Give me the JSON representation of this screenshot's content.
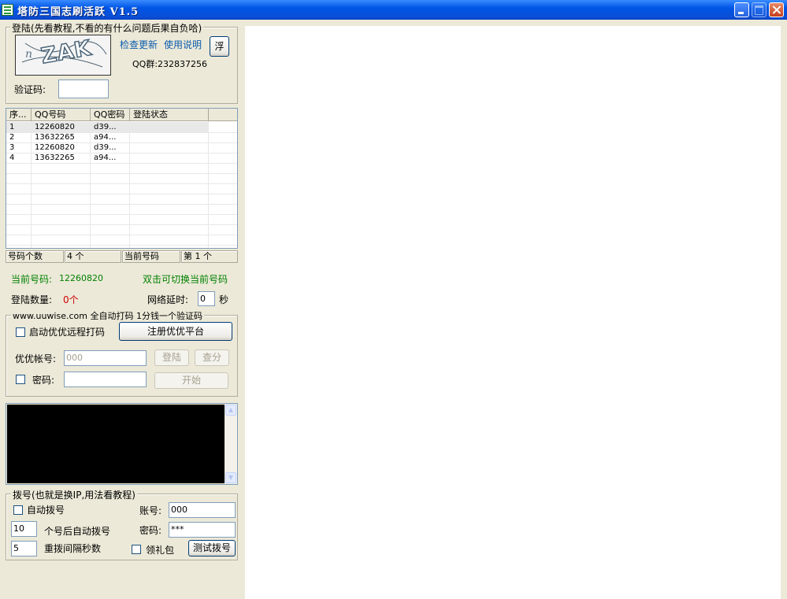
{
  "window": {
    "title": "塔防三国志刷活跃 V1.5"
  },
  "login": {
    "group_title": "登陆(先看教程,不看的有什么问题后果自负哈)",
    "captcha_text": "ZAK",
    "check_update": "检查更新",
    "instructions": "使用说明",
    "float_button": "浮",
    "qq_group": "QQ群:232837256",
    "captcha_label": "验证码:",
    "captcha_value": ""
  },
  "accounts": {
    "columns": [
      "序...",
      "QQ号码",
      "QQ密码",
      "登陆状态"
    ],
    "rows": [
      {
        "no": "1",
        "qq": "12260820",
        "pwd": "d39...",
        "status": ""
      },
      {
        "no": "2",
        "qq": "13632265",
        "pwd": "a94...",
        "status": ""
      },
      {
        "no": "3",
        "qq": "12260820",
        "pwd": "d39...",
        "status": ""
      },
      {
        "no": "4",
        "qq": "13632265",
        "pwd": "a94...",
        "status": ""
      }
    ],
    "status_bar": [
      "号码个数",
      "4 个",
      "当前号码",
      "第 1 个"
    ]
  },
  "current": {
    "label": "当前号码:",
    "value": "12260820",
    "hint": "双击可切换当前号码",
    "login_count_label": "登陆数量:",
    "login_count_value": "0个",
    "delay_label": "网络延时:",
    "delay_value": "0",
    "delay_unit": "秒"
  },
  "uuwise": {
    "group_title": "www.uuwise.com 全自动打码 1分钱一个验证码",
    "enable_label": "启动优优远程打码",
    "register_button": "注册优优平台",
    "account_label": "优优帐号:",
    "account_value": "000",
    "login_button": "登陆",
    "score_button": "查分",
    "password_label": "密码:",
    "password_value": "",
    "start_button": "开始"
  },
  "dial": {
    "group_title": "拨号(也就是换IP,用法看教程)",
    "auto_label": "自动拨号",
    "account_label": "账号:",
    "account_value": "000",
    "count_value": "10",
    "count_label": "个号后自动拨号",
    "password_label": "密码:",
    "password_value": "***",
    "interval_value": "5",
    "interval_label": "重拨间隔秒数",
    "gift_label": "领礼包",
    "test_button": "测试拨号"
  },
  "colors": {
    "title_bar": "#0055E5",
    "link": "#0B5CAD",
    "green": "#008000",
    "red": "#CC0000"
  }
}
